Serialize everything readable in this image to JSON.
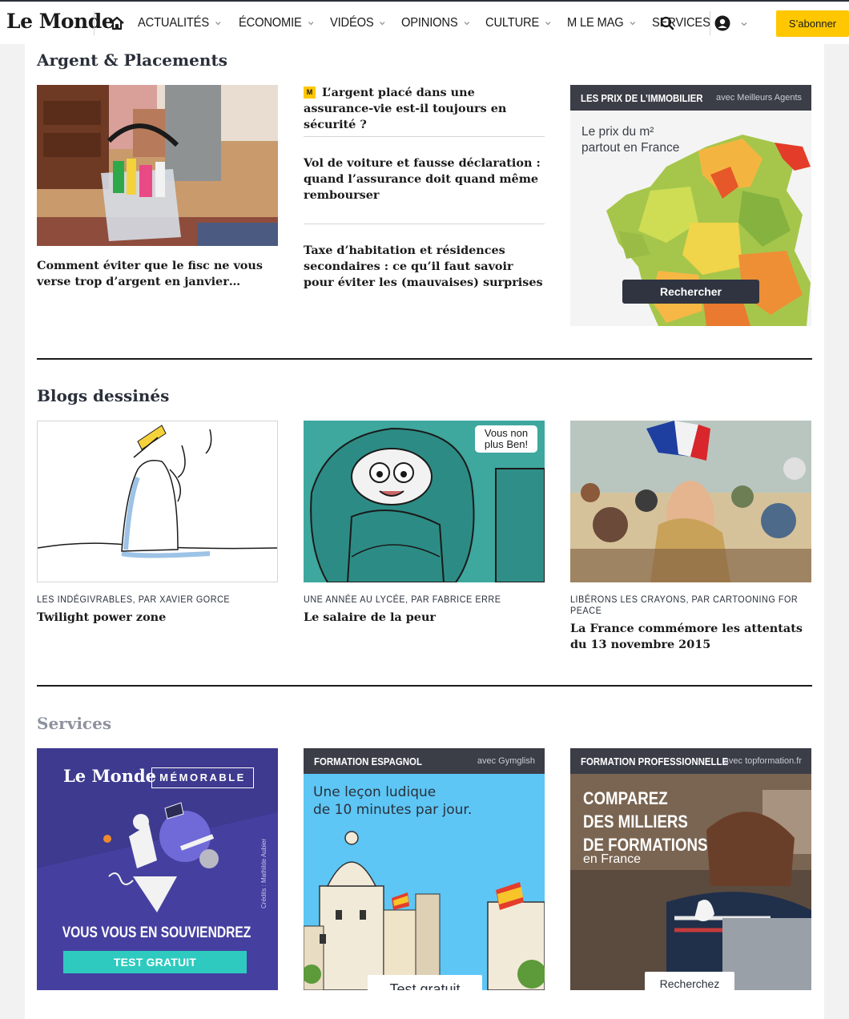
{
  "header": {
    "logo": "Le Monde",
    "nav": [
      "ACTUALITÉS",
      "ÉCONOMIE",
      "VIDÉOS",
      "OPINIONS",
      "CULTURE",
      "M LE MAG",
      "SERVICES"
    ],
    "subscribe_label": "S’abonner"
  },
  "argent": {
    "title": "Argent & Placements",
    "main_headline": "Comment éviter que le fisc ne vous verse trop d’argent en janvier…",
    "premium_badge": "M",
    "list": [
      "L’argent placé dans une assurance-vie est-il toujours en sécurité ?",
      "Vol de voiture et fausse déclaration : quand l’assurance doit quand même rembourser",
      "Taxe d’habitation et résidences secondaires : ce qu’il faut savoir pour éviter les (mauvaises) surprises"
    ],
    "widget": {
      "title": "LES PRIX DE L’IMMOBILIER",
      "partner": "avec Meilleurs Agents",
      "caption_line1": "Le prix du m²",
      "caption_line2": "partout en France",
      "button": "Rechercher"
    }
  },
  "blogs": {
    "title": "Blogs dessinés",
    "items": [
      {
        "kicker": "LES INDÉGIVRABLES, PAR XAVIER GORCE",
        "headline": "Twilight power zone"
      },
      {
        "kicker": "UNE ANNÉE AU LYCÉE, PAR FABRICE ERRE",
        "headline": "Le salaire de la peur",
        "bubble_line1": "Vous non",
        "bubble_line2": "plus Ben!"
      },
      {
        "kicker": "LIBÉRONS LES CRAYONS, PAR CARTOONING FOR PEACE",
        "headline": "La France commémore les attentats du 13 novembre 2015"
      }
    ]
  },
  "services": {
    "title": "Services",
    "memorable": {
      "logo": "Le Monde",
      "badge": "MÉMORABLE",
      "credit": "Crédits : Mathilde Aubier",
      "tagline": "VOUS VOUS EN SOUVIENDREZ",
      "button": "TEST GRATUIT"
    },
    "espagnol": {
      "title": "FORMATION ESPAGNOL",
      "partner": "avec Gymglish",
      "line1": "Une leçon ludique",
      "line2": "de 10 minutes par jour.",
      "button": "Test gratuit"
    },
    "pro": {
      "title": "FORMATION PROFESSIONNELLE",
      "partner": "avec topformation.fr",
      "line1": "COMPAREZ",
      "line2": "DES MILLIERS",
      "line3": "DE FORMATIONS",
      "line4": "en France",
      "button": "Recherchez"
    }
  },
  "colors": {
    "accent_yellow": "#ffc700",
    "dark_bar": "#3b3e47",
    "memorable_bg": "#3d3a8f",
    "teal": "#2ecabf",
    "sky": "#5dc6f5"
  }
}
